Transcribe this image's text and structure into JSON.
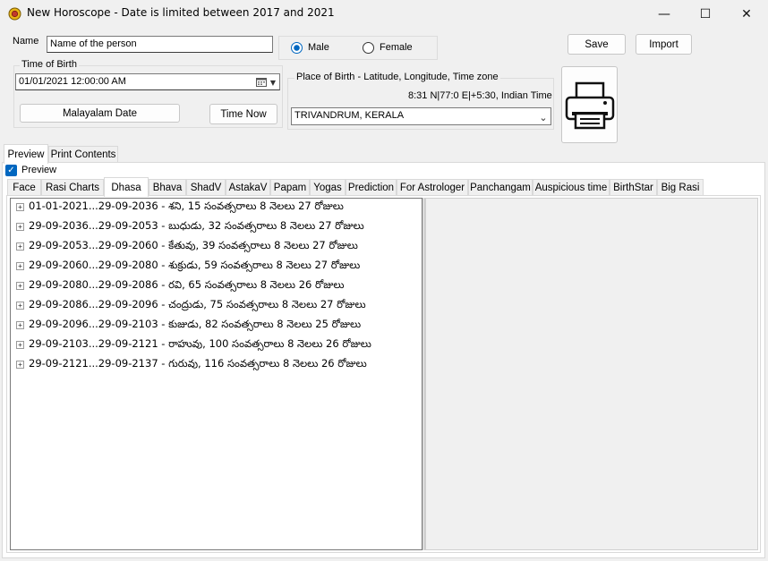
{
  "window": {
    "title": "New Horoscope - Date is limited between 2017 and 2021",
    "minimize": "—",
    "maximize": "☐",
    "close": "✕"
  },
  "form": {
    "name_label": "Name",
    "name_value": "Name of the person",
    "gender": {
      "male": "Male",
      "female": "Female",
      "selected": "Male"
    },
    "save_label": "Save",
    "import_label": "Import",
    "time_of_birth": {
      "group_title": "Time of Birth",
      "datetime_value": "01/01/2021  12:00:00 AM",
      "malayalam_date_label": "Malayalam Date",
      "time_now_label": "Time Now"
    },
    "place_of_birth": {
      "group_title": "Place of Birth - Latitude, Longitude, Time zone",
      "coords": "8:31 N|77:0 E|+5:30, Indian Time",
      "selected_place": "TRIVANDRUM, KERALA"
    }
  },
  "outer_tabs": [
    "Preview",
    "Print Contents"
  ],
  "preview_checkbox": {
    "label": "Preview",
    "checked": true
  },
  "inner_tabs": [
    "Face",
    "Rasi Charts",
    "Dhasa",
    "Bhava",
    "ShadV",
    "AstakaV",
    "Papam",
    "Yogas",
    "Prediction",
    "For Astrologer",
    "Panchangam",
    "Auspicious time",
    "BirthStar",
    "Big Rasi"
  ],
  "active_inner_tab": "Dhasa",
  "dhasa_rows": [
    "01-01-2021...29-09-2036 - శని, 15 సంవత్సరాలు 8 నెలలు 27 రోజులు",
    "29-09-2036...29-09-2053 - బుధుడు, 32 సంవత్సరాలు 8 నెలలు 27 రోజులు",
    "29-09-2053...29-09-2060 - కేతువు, 39 సంవత్సరాలు 8 నెలలు 27 రోజులు",
    "29-09-2060...29-09-2080 - శుక్రుడు, 59 సంవత్సరాలు 8 నెలలు 27 రోజులు",
    "29-09-2080...29-09-2086 - రవి, 65 సంవత్సరాలు 8 నెలలు 26 రోజులు",
    "29-09-2086...29-09-2096 - చంద్రుడు, 75 సంవత్సరాలు 8 నెలలు 27 రోజులు",
    "29-09-2096...29-09-2103 - కుజుడు, 82 సంవత్సరాలు 8 నెలలు 25 రోజులు",
    "29-09-2103...29-09-2121 - రాహువు, 100 సంవత్సరాలు 8 నెలలు 26 రోజులు",
    "29-09-2121...29-09-2137 - గురువు, 116 సంవత్సరాలు 8 నెలలు 26 రోజులు"
  ],
  "icons": {
    "app": "sun-icon",
    "printer": "printer-icon",
    "calendar": "calendar-icon"
  },
  "colors": {
    "accent": "#0067c0",
    "checkbox": "#0067c0"
  }
}
